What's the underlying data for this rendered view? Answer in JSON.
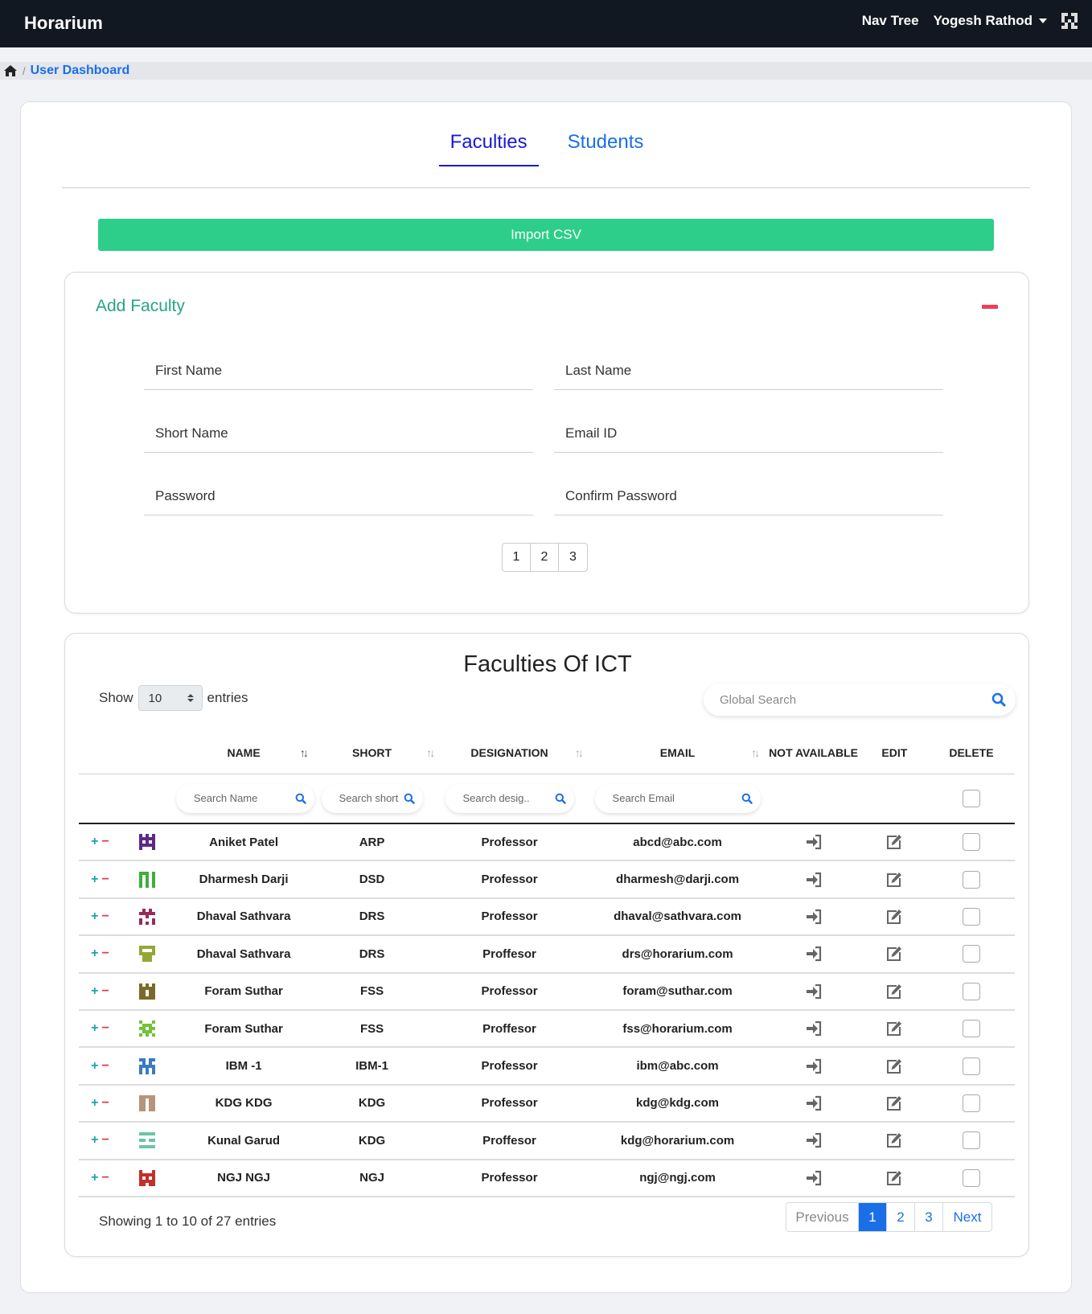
{
  "navbar": {
    "brand": "Horarium",
    "nav_tree": "Nav Tree",
    "user_name": "Yogesh Rathod"
  },
  "breadcrumb": {
    "current": "User Dashboard"
  },
  "tabs": [
    {
      "label": "Faculties"
    },
    {
      "label": "Students"
    }
  ],
  "import_button": "Import CSV",
  "add_faculty": {
    "title": "Add Faculty",
    "fields": {
      "first_name": "First Name",
      "last_name": "Last Name",
      "short_name": "Short Name",
      "email": "Email ID",
      "password": "Password",
      "confirm_password": "Confirm Password"
    },
    "pages": [
      "1",
      "2",
      "3"
    ]
  },
  "faculty_table": {
    "title": "Faculties Of ICT",
    "show_label": "Show",
    "entries_label": "entries",
    "entries_value": "10",
    "global_search_placeholder": "Global Search",
    "headers": {
      "name": "NAME",
      "short": "SHORT",
      "designation": "DESIGNATION",
      "email": "EMAIL",
      "not_available": "NOT AVAILABLE",
      "edit": "EDIT",
      "delete": "DELETE"
    },
    "filters": {
      "name": "Search Name",
      "short": "Search short",
      "designation": "Search desig..",
      "email": "Search Email"
    },
    "rows": [
      {
        "name": "Aniket Patel",
        "short": "ARP",
        "designation": "Professor",
        "email": "abcd@abc.com",
        "avatar_color": "#5a2a8a"
      },
      {
        "name": "Dharmesh Darji",
        "short": "DSD",
        "designation": "Professor",
        "email": "dharmesh@darji.com",
        "avatar_color": "#3fae3a"
      },
      {
        "name": "Dhaval Sathvara",
        "short": "DRS",
        "designation": "Professor",
        "email": "dhaval@sathvara.com",
        "avatar_color": "#9a2a5e"
      },
      {
        "name": "Dhaval Sathvara",
        "short": "DRS",
        "designation": "Proffesor",
        "email": "drs@horarium.com",
        "avatar_color": "#93a834"
      },
      {
        "name": "Foram Suthar",
        "short": "FSS",
        "designation": "Professor",
        "email": "foram@suthar.com",
        "avatar_color": "#7a6a2a"
      },
      {
        "name": "Foram Suthar",
        "short": "FSS",
        "designation": "Proffesor",
        "email": "fss@horarium.com",
        "avatar_color": "#72c23a"
      },
      {
        "name": "IBM -1",
        "short": "IBM-1",
        "designation": "Professor",
        "email": "ibm@abc.com",
        "avatar_color": "#3a7ac2"
      },
      {
        "name": "KDG KDG",
        "short": "KDG",
        "designation": "Professor",
        "email": "kdg@kdg.com",
        "avatar_color": "#b89478"
      },
      {
        "name": "Kunal Garud",
        "short": "KDG",
        "designation": "Proffesor",
        "email": "kdg@horarium.com",
        "avatar_color": "#6ac4a8"
      },
      {
        "name": "NGJ NGJ",
        "short": "NGJ",
        "designation": "Professor",
        "email": "ngj@ngj.com",
        "avatar_color": "#c2302a"
      }
    ],
    "showing_text": "Showing 1 to 10 of 27 entries",
    "pagination": {
      "previous": "Previous",
      "pages": [
        "1",
        "2",
        "3"
      ],
      "next": "Next",
      "active_page": "1"
    }
  }
}
